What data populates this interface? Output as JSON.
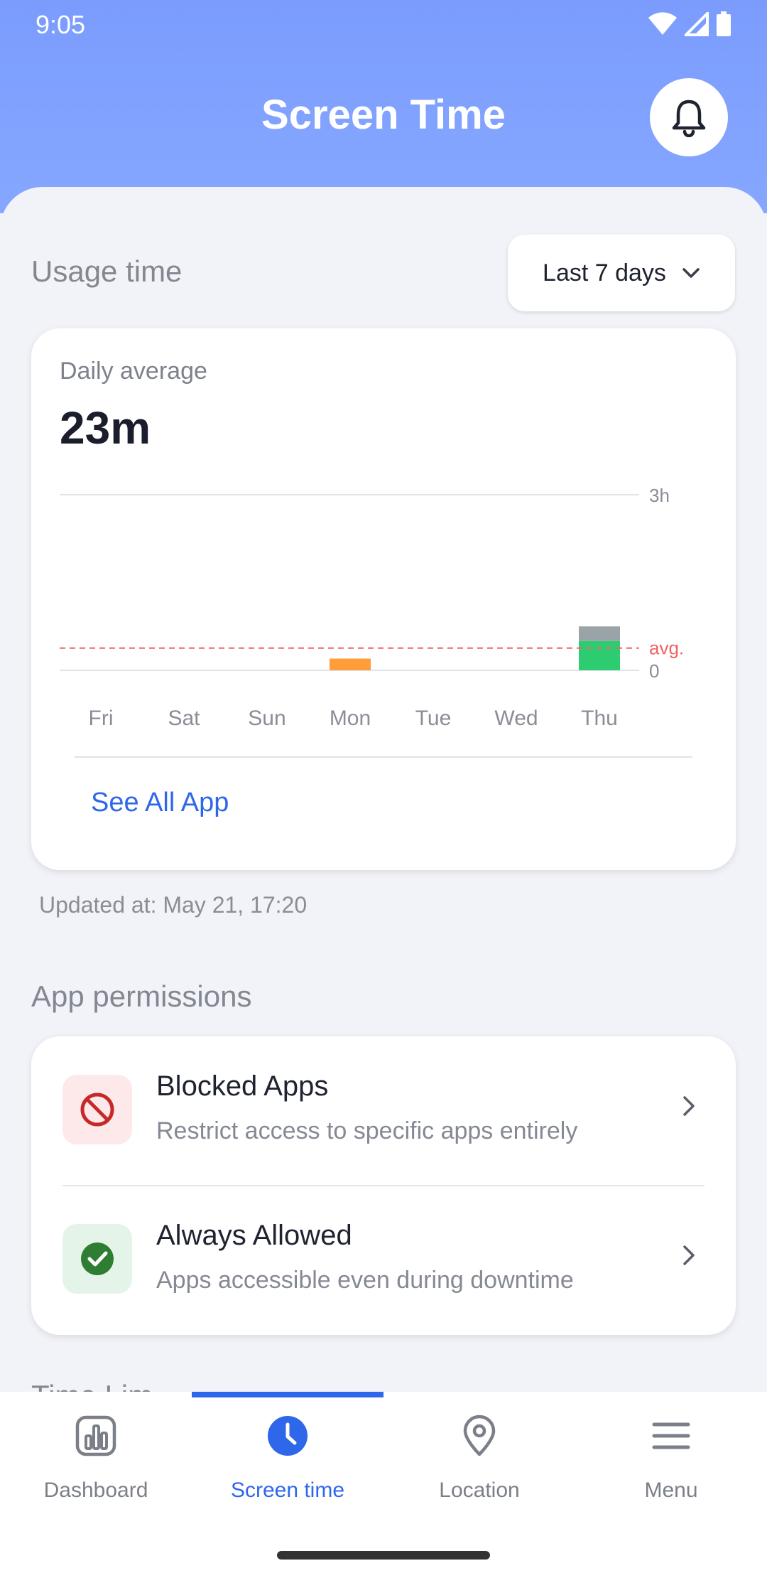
{
  "status_bar": {
    "time": "9:05"
  },
  "header": {
    "title": "Screen Time"
  },
  "usage": {
    "section_label": "Usage time",
    "range_label": "Last 7 days",
    "daily_average_label": "Daily average",
    "daily_average_value": "23m",
    "see_all": "See All App",
    "updated": "Updated at: May 21, 17:20"
  },
  "chart_data": {
    "type": "bar",
    "categories": [
      "Fri",
      "Sat",
      "Sun",
      "Mon",
      "Tue",
      "Wed",
      "Thu"
    ],
    "series": [
      {
        "values": [
          0,
          0,
          0,
          0.2,
          0,
          0,
          0.5
        ],
        "color": "#2ecc71"
      },
      {
        "values": [
          0,
          0,
          0,
          0,
          0,
          0,
          0.25
        ],
        "color": "#9aa3a8"
      }
    ],
    "bar_colors_override": {
      "Mon": "#ff9d3b"
    },
    "y_ticks": [
      "3h",
      "0"
    ],
    "ylim": [
      0,
      3
    ],
    "avg_label": "avg.",
    "avg_value": 0.38,
    "avg_color": "#ef6464",
    "stacked": true
  },
  "permissions": {
    "section_label": "App permissions",
    "items": [
      {
        "title": "Blocked Apps",
        "subtitle": "Restrict access to specific apps entirely",
        "icon": "blocked-icon"
      },
      {
        "title": "Always Allowed",
        "subtitle": "Apps accessible even during downtime",
        "icon": "check-circle-icon"
      }
    ]
  },
  "next_section_peek": "Time Lim",
  "nav": {
    "items": [
      {
        "label": "Dashboard",
        "icon": "bar-chart-icon"
      },
      {
        "label": "Screen time",
        "icon": "clock-icon"
      },
      {
        "label": "Location",
        "icon": "location-pin-icon"
      },
      {
        "label": "Menu",
        "icon": "menu-icon"
      }
    ],
    "active_index": 1
  }
}
